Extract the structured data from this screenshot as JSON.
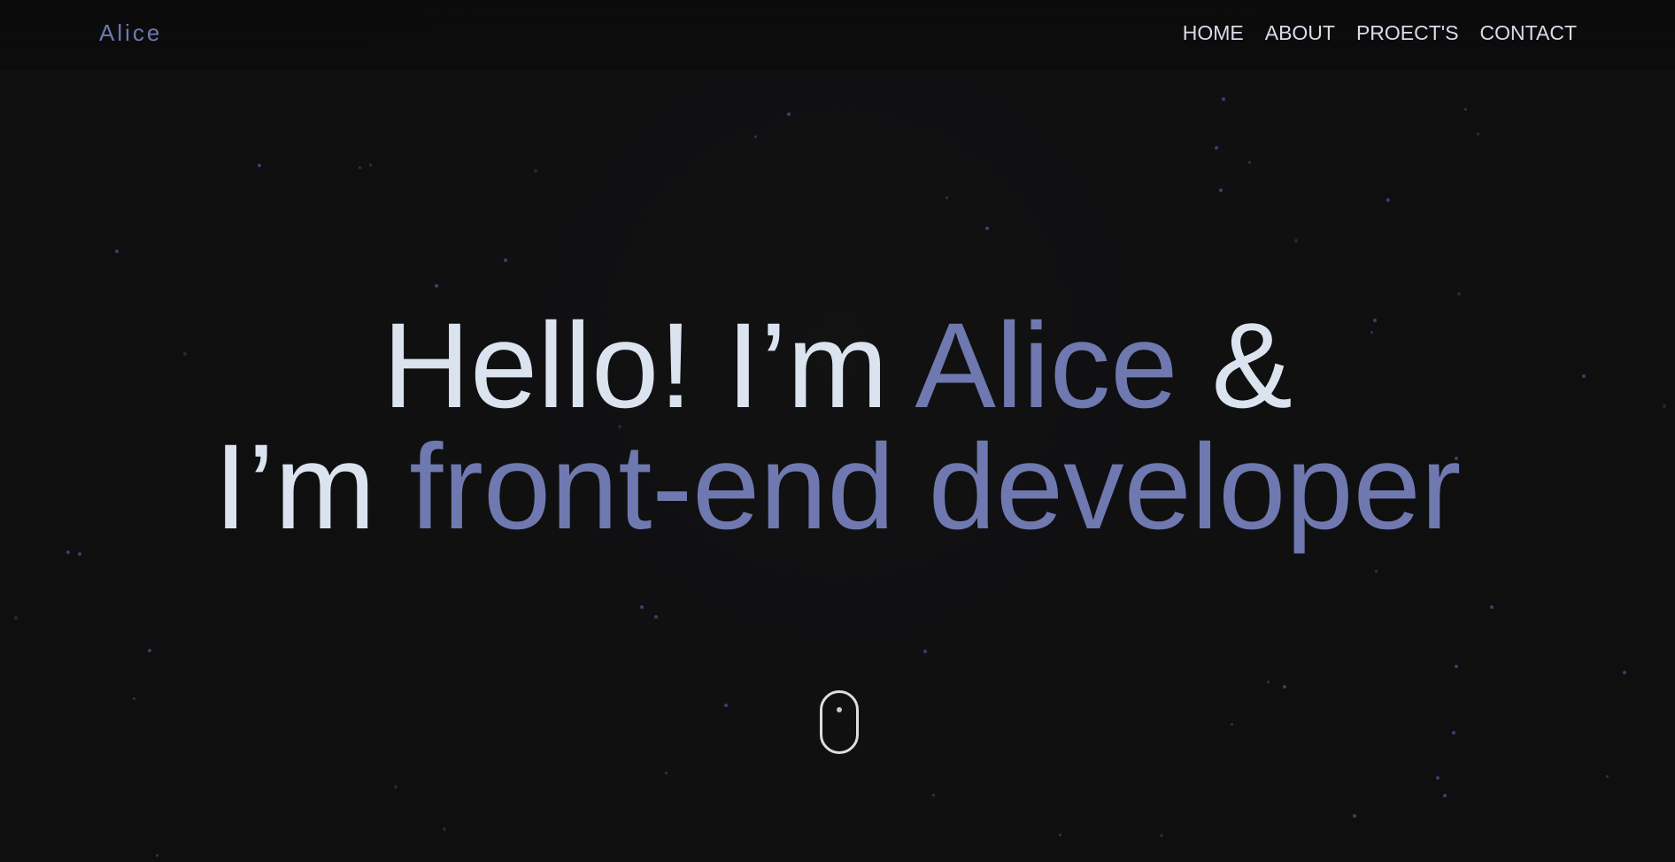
{
  "colors": {
    "background": "#0f0f10",
    "accent": "#6f79b0",
    "text": "#dbe3ef",
    "nav_text": "#d8dce7",
    "stars": "#4a4f8f"
  },
  "header": {
    "brand": "Alice",
    "nav": [
      {
        "label": "HOME"
      },
      {
        "label": "ABOUT"
      },
      {
        "label": "PROECT'S"
      },
      {
        "label": "CONTACT"
      }
    ]
  },
  "hero": {
    "line1": {
      "pre": "Hello! I’m ",
      "name": "Alice",
      "post": " &"
    },
    "line2": {
      "pre": "I’m ",
      "role": "front-end developer"
    }
  },
  "scroll_indicator": {
    "icon": "mouse-scroll-icon"
  }
}
